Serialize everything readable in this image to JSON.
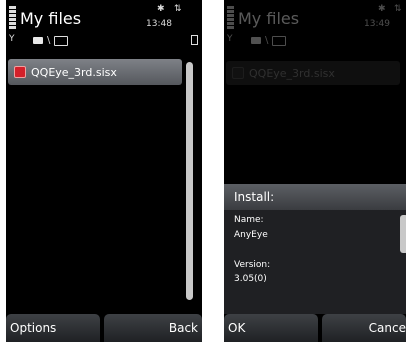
{
  "left": {
    "title": "My files",
    "time": "13:48",
    "file": "QQEye_3rd.sisx",
    "softkeys": {
      "left": "Options",
      "right": "Back"
    }
  },
  "right": {
    "title": "My files",
    "time": "13:49",
    "file": "QQEye_3rd.sisx",
    "dialog": {
      "heading": "Install:",
      "name_label": "Name:",
      "name_value": "AnyEye",
      "version_label": "Version:",
      "version_value": "3.05(0)"
    },
    "softkeys": {
      "left": "OK",
      "right": "Cance"
    }
  },
  "path_separator": "\\",
  "icons": [
    "signal-icon",
    "bluetooth-icon",
    "antenna-icon",
    "drive-icon",
    "folder-icon",
    "battery-icon",
    "sisx-file-icon"
  ]
}
